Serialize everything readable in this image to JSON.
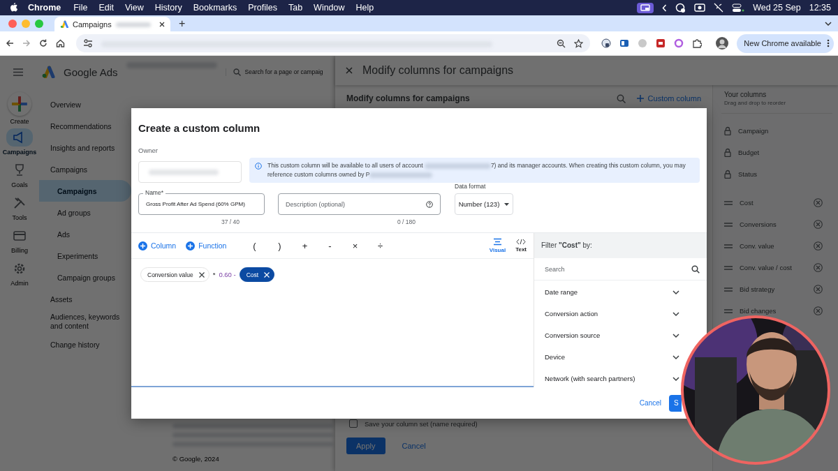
{
  "menu_bar": {
    "app": "Chrome",
    "menus": [
      "File",
      "Edit",
      "View",
      "History",
      "Bookmarks",
      "Profiles",
      "Tab",
      "Window",
      "Help"
    ],
    "date": "Wed 25 Sep",
    "time": "12:35"
  },
  "browser": {
    "tabs": [
      {
        "title": "Campaigns",
        "selected": true
      }
    ],
    "new_tab": "+",
    "update_button": "New Chrome available"
  },
  "ads_page": {
    "product": "Google Ads",
    "search_placeholder": "Search for a page or campaig",
    "rail": [
      {
        "kind": "create",
        "label": "Create",
        "selected": false
      },
      {
        "kind": "campaigns",
        "label": "Campaigns",
        "selected": true
      },
      {
        "kind": "goals",
        "label": "Goals",
        "selected": false
      },
      {
        "kind": "tools",
        "label": "Tools",
        "selected": false
      },
      {
        "kind": "billing",
        "label": "Billing",
        "selected": false
      },
      {
        "kind": "admin",
        "label": "Admin",
        "selected": false
      }
    ],
    "nav": [
      {
        "kind": "section",
        "label": "Overview",
        "selected": false
      },
      {
        "kind": "section",
        "label": "Recommendations",
        "selected": false
      },
      {
        "kind": "section",
        "label": "Insights and reports",
        "selected": false
      },
      {
        "kind": "section",
        "label": "Campaigns",
        "selected": false
      },
      {
        "kind": "sub",
        "label": "Campaigns",
        "selected": true
      },
      {
        "kind": "sub",
        "label": "Ad groups",
        "selected": false
      },
      {
        "kind": "sub",
        "label": "Ads",
        "selected": false
      },
      {
        "kind": "sub",
        "label": "Experiments",
        "selected": false
      },
      {
        "kind": "sub",
        "label": "Campaign groups",
        "selected": false
      },
      {
        "kind": "section",
        "label": "Assets",
        "selected": false
      },
      {
        "kind": "section",
        "label": "Audiences, keywords and content",
        "selected": false
      },
      {
        "kind": "section",
        "label": "Change history",
        "selected": false
      }
    ],
    "copyright": "© Google, 2024"
  },
  "columns_panel": {
    "title": "Modify columns for campaigns",
    "subtitle": "Modify columns for campaigns",
    "custom_column": "Custom column",
    "your_columns": {
      "title": "Your columns",
      "hint": "Drag and drop to reorder",
      "items": [
        {
          "label": "Campaign",
          "locked": true
        },
        {
          "label": "Budget",
          "locked": true
        },
        {
          "label": "Status",
          "locked": true
        },
        {
          "label": "Cost",
          "locked": false
        },
        {
          "label": "Conversions",
          "locked": false
        },
        {
          "label": "Conv. value",
          "locked": false
        },
        {
          "label": "Conv. value / cost",
          "locked": false
        },
        {
          "label": "Bid strategy",
          "locked": false
        },
        {
          "label": "Bid changes",
          "locked": false
        }
      ]
    },
    "save_set": {
      "label": "Save your column set (name required)",
      "checked": false
    },
    "apply": "Apply",
    "cancel": "Cancel"
  },
  "dialog": {
    "title": "Create a custom column",
    "owner_label": "Owner",
    "info": {
      "text_before": "This custom column will be available to all users of account",
      "text_after": "7) and its manager accounts. When creating this custom column, you may reference custom columns owned by P"
    },
    "name_field": {
      "label": "Name*",
      "value": "Gross Profit After Ad Spend (60% GPM)",
      "counter": "37 / 40"
    },
    "description_field": {
      "placeholder": "Description (optional)",
      "counter": "0 / 180"
    },
    "data_format": {
      "label": "Data format",
      "value": "Number (123)"
    },
    "toolbar": [
      {
        "kind": "add",
        "label": "Column"
      },
      {
        "kind": "add",
        "label": "Function"
      },
      {
        "kind": "operator",
        "label": "("
      },
      {
        "kind": "operator",
        "label": ")"
      },
      {
        "kind": "operator",
        "label": "+"
      },
      {
        "kind": "operator",
        "label": "-"
      },
      {
        "kind": "operator",
        "label": "×"
      },
      {
        "kind": "operator",
        "label": "÷"
      }
    ],
    "modes": [
      {
        "kind": "visual",
        "label": "Visual",
        "selected": true
      },
      {
        "kind": "text",
        "label": "Text",
        "selected": false
      }
    ],
    "formula": [
      {
        "kind": "chip",
        "label": "Conversion value",
        "selected": false
      },
      {
        "kind": "operator",
        "label": "*"
      },
      {
        "kind": "number",
        "label": "0.60 -"
      },
      {
        "kind": "chip",
        "label": "Cost",
        "selected": true
      }
    ],
    "filter": {
      "title": "Filter **\"Cost\"** by:",
      "search_placeholder": "Search",
      "options": [
        {
          "label": "Date range"
        },
        {
          "label": "Conversion action"
        },
        {
          "label": "Conversion source"
        },
        {
          "label": "Device"
        },
        {
          "label": "Network (with search partners)"
        }
      ]
    },
    "cancel": "Cancel",
    "save": "S"
  }
}
